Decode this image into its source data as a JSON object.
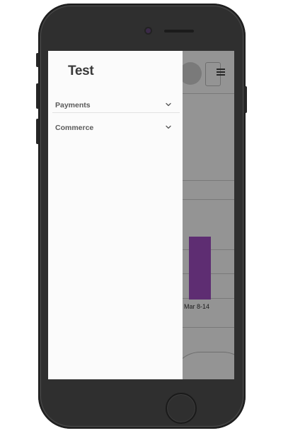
{
  "drawer": {
    "title": "Test",
    "items": [
      {
        "label": "Payments"
      },
      {
        "label": "Commerce"
      }
    ]
  },
  "background": {
    "chart_bar_label": "Mar 8-14",
    "bar_color": "#a24fc4"
  },
  "icons": {
    "chevron": "chevron-down-icon",
    "menu": "hamburger-menu-icon"
  }
}
